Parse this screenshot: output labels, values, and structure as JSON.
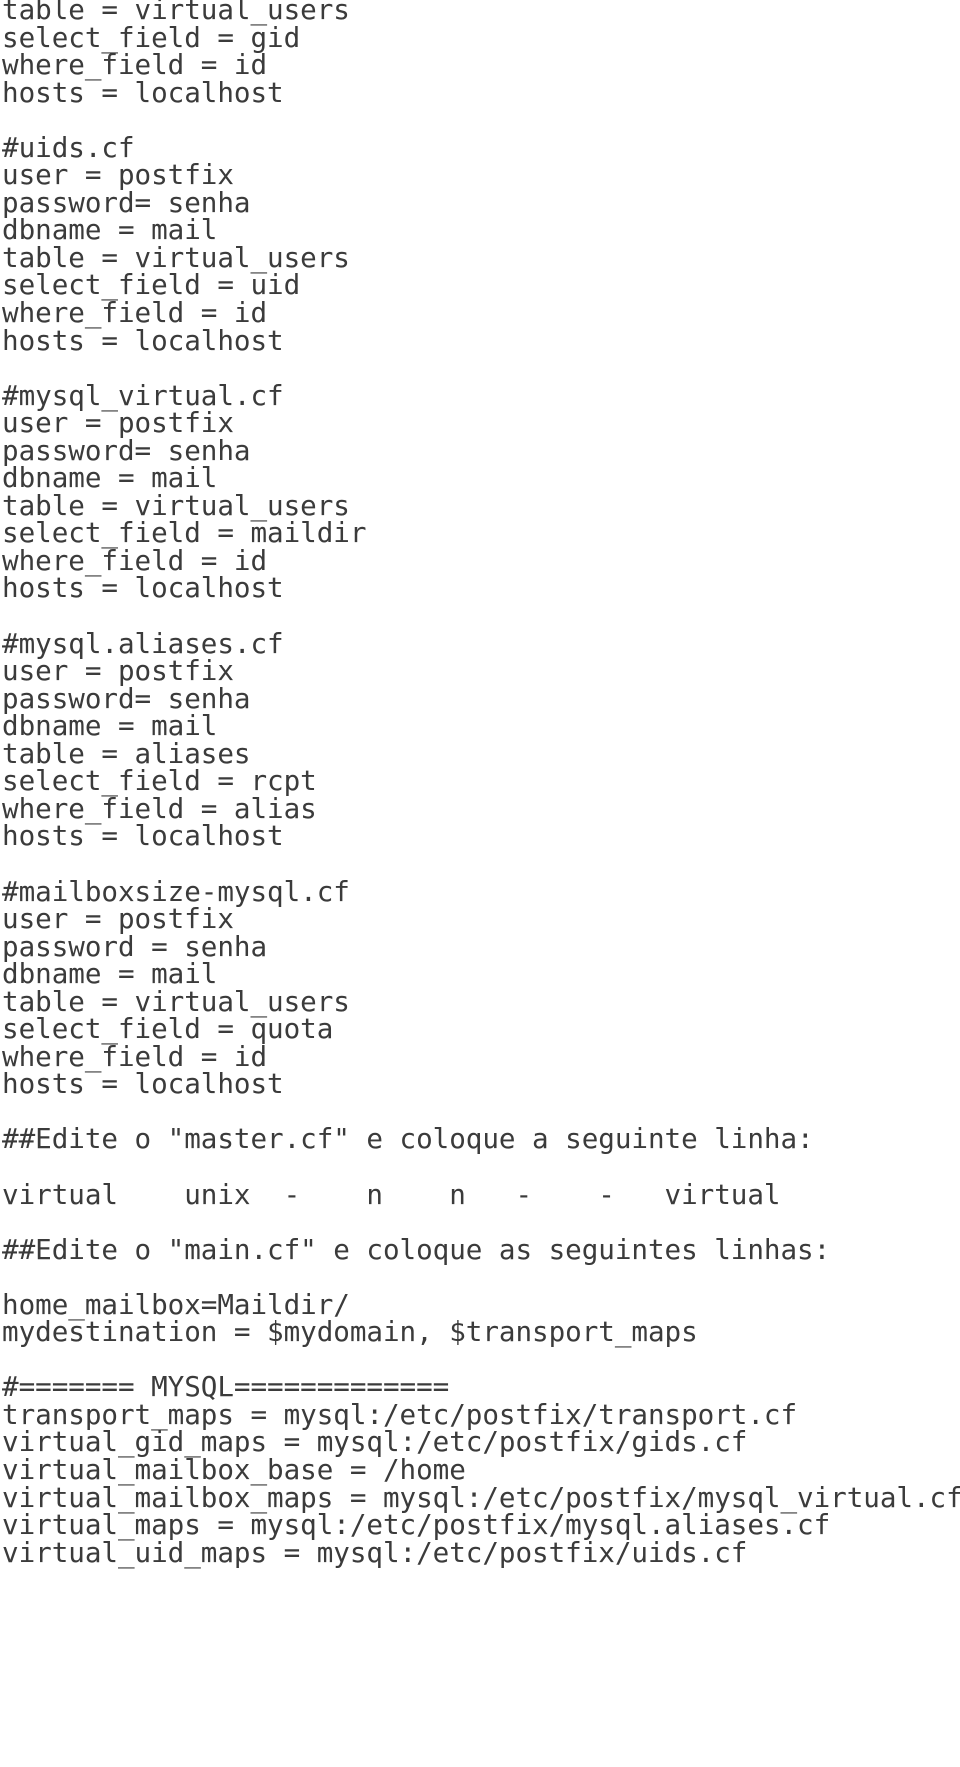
{
  "document": {
    "type": "plain-text-code-listing",
    "language": "postfix-mysql-config",
    "text_color": "#3b3b3b",
    "background_color": "#ffffff",
    "lines": [
      "table = virtual_users",
      "select_field = gid",
      "where_field = id",
      "hosts = localhost",
      "",
      "#uids.cf",
      "user = postfix",
      "password= senha",
      "dbname = mail",
      "table = virtual_users",
      "select_field = uid",
      "where_field = id",
      "hosts = localhost",
      "",
      "#mysql_virtual.cf",
      "user = postfix",
      "password= senha",
      "dbname = mail",
      "table = virtual_users",
      "select_field = maildir",
      "where_field = id",
      "hosts = localhost",
      "",
      "#mysql.aliases.cf",
      "user = postfix",
      "password= senha",
      "dbname = mail",
      "table = aliases",
      "select_field = rcpt",
      "where_field = alias",
      "hosts = localhost",
      "",
      "#mailboxsize-mysql.cf",
      "user = postfix",
      "password = senha",
      "dbname = mail",
      "table = virtual_users",
      "select_field = quota",
      "where_field = id",
      "hosts = localhost",
      "",
      "##Edite o \"master.cf\" e coloque a seguinte linha:",
      "",
      "virtual    unix  -    n    n   -    -   virtual",
      "",
      "##Edite o \"main.cf\" e coloque as seguintes linhas:",
      "",
      "home_mailbox=Maildir/",
      "mydestination = $mydomain, $transport_maps",
      "",
      "#======= MYSQL=============",
      "transport_maps = mysql:/etc/postfix/transport.cf",
      "virtual_gid_maps = mysql:/etc/postfix/gids.cf",
      "virtual_mailbox_base = /home",
      "virtual_mailbox_maps = mysql:/etc/postfix/mysql_virtual.cf",
      "virtual_maps = mysql:/etc/postfix/mysql.aliases.cf",
      "virtual_uid_maps = mysql:/etc/postfix/uids.cf"
    ],
    "sections": [
      {
        "name": "gids.cf-continuation",
        "heading": "",
        "entries": [
          "table = virtual_users",
          "select_field = gid",
          "where_field = id",
          "hosts = localhost"
        ]
      },
      {
        "name": "uids.cf",
        "heading": "#uids.cf",
        "entries": [
          "user = postfix",
          "password= senha",
          "dbname = mail",
          "table = virtual_users",
          "select_field = uid",
          "where_field = id",
          "hosts = localhost"
        ]
      },
      {
        "name": "mysql_virtual.cf",
        "heading": "#mysql_virtual.cf",
        "entries": [
          "user = postfix",
          "password= senha",
          "dbname = mail",
          "table = virtual_users",
          "select_field = maildir",
          "where_field = id",
          "hosts = localhost"
        ]
      },
      {
        "name": "mysql.aliases.cf",
        "heading": "#mysql.aliases.cf",
        "entries": [
          "user = postfix",
          "password= senha",
          "dbname = mail",
          "table = aliases",
          "select_field = rcpt",
          "where_field = alias",
          "hosts = localhost"
        ]
      },
      {
        "name": "mailboxsize-mysql.cf",
        "heading": "#mailboxsize-mysql.cf",
        "entries": [
          "user = postfix",
          "password = senha",
          "dbname = mail",
          "table = virtual_users",
          "select_field = quota",
          "where_field = id",
          "hosts = localhost"
        ]
      },
      {
        "name": "master.cf-instruction",
        "heading": "##Edite o \"master.cf\" e coloque a seguinte linha:",
        "entries": [
          "virtual    unix  -    n    n   -    -   virtual"
        ]
      },
      {
        "name": "main.cf-instruction",
        "heading": "##Edite o \"main.cf\" e coloque as seguintes linhas:",
        "entries": [
          "home_mailbox=Maildir/",
          "mydestination = $mydomain, $transport_maps"
        ]
      },
      {
        "name": "mysql-maps",
        "heading": "#======= MYSQL=============",
        "entries": [
          "transport_maps = mysql:/etc/postfix/transport.cf",
          "virtual_gid_maps = mysql:/etc/postfix/gids.cf",
          "virtual_mailbox_base = /home",
          "virtual_mailbox_maps = mysql:/etc/postfix/mysql_virtual.cf",
          "virtual_maps = mysql:/etc/postfix/mysql.aliases.cf",
          "virtual_uid_maps = mysql:/etc/postfix/uids.cf"
        ]
      }
    ]
  }
}
